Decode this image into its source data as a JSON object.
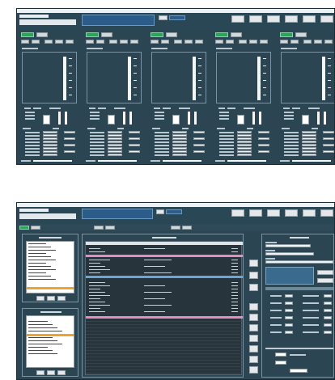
{
  "windows": [
    {
      "title": "",
      "channels": [
        {
          "name": ""
        },
        {
          "name": ""
        },
        {
          "name": ""
        },
        {
          "name": ""
        },
        {
          "name": ""
        }
      ]
    },
    {
      "title": "",
      "panels": {
        "left_top": "",
        "center": "",
        "right": ""
      }
    }
  ]
}
